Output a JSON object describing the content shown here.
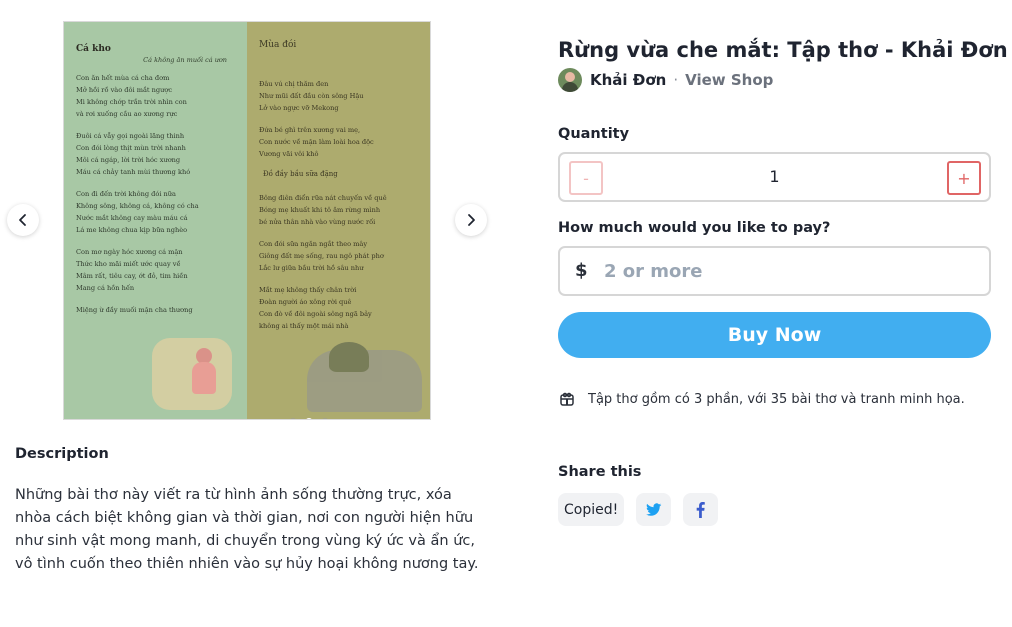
{
  "carousel": {
    "left_page": {
      "title": "Cá kho",
      "subtitle": "Cá không ăn muối cá ươn",
      "stanzas": [
        [
          "Con ăn hết mùa cá cha đơm",
          "Mở hồi rồ vào đôi mắt ngược",
          "Mi không chớp trắn trời nhìn con",
          "và rơi xuống cầu ao xương rực"
        ],
        [
          "Đuôi cá vẫy gọi ngoài lãng thinh",
          "Con đói lòng thịt mùn trời nhanh",
          "Môi cá ngáp, lời trời hóc xương",
          "Máu cá chảy tanh mùi thương khó"
        ],
        [
          "Con đi đến trời không đói nữa",
          "Không sông, không cá, không có cha",
          "Nước mắt không cay màu máu cá",
          "Lá me không chua kịp bữa nghèo"
        ],
        [
          "Con mơ ngày hóc xương cá mặn",
          "Thức kho mãi miết ước quay về",
          "Mâm rất, tiêu cay, ớt đỏ, tim hiền",
          "Mang cá hồn hến"
        ],
        [
          "Miệng ừ đầy muối mặn cha thương"
        ]
      ]
    },
    "right_page": {
      "title": "Mùa đói",
      "stanzas": [
        [
          "Đâu vú chị thăm đen",
          "Như mũi đất đầu còn sông Hậu",
          "Lở vào ngực vỡ Mekong"
        ],
        [
          "Đứa bé ghì trên xương vai mẹ,",
          "Con nước về mặn làm loài hoa độc",
          "Vương vãi vôi khô"
        ],
        [
          "Bông điên điển rữa nát chuyến về quê",
          "Bóng mẹ khuất khi tô ăm rừng mình",
          "bé nửa thân nhà vào vùng nước rối"
        ],
        [
          "Con đói sữa ngăn ngắt theo mây",
          "Giông đất mẹ sống, rau ngô phát phơ",
          "Lắc lư giữa bầu trời hồ sâu như"
        ],
        [
          "Mắt mẹ không thấy chân trời",
          "Đoàn người áo xông rời quê",
          "Con đò về đôi ngoài sông ngã bảy",
          "không ai thấy một mái nhà"
        ]
      ],
      "heading_mid": "Đồ đầy bầu sữa đặng"
    },
    "slide_count": 3,
    "active_slide": 2
  },
  "description": {
    "heading": "Description",
    "body": "Những bài thơ này viết ra từ hình ảnh sống thường trực, xóa nhòa cách biệt không gian và thời gian, nơi con người hiện hữu như sinh vật mong manh, di chuyển trong vùng ký ức và ẩn ức, vô tình cuốn theo thiên nhiên vào sự hủy hoại không nương tay."
  },
  "product": {
    "title": "Rừng vừa che mắt: Tập thơ - Khải Đơn",
    "author": "Khải Đơn",
    "separator": "·",
    "view_shop": "View Shop"
  },
  "quantity": {
    "label": "Quantity",
    "value": "1",
    "minus": "-",
    "plus": "+"
  },
  "price": {
    "label": "How much would you like to pay?",
    "currency": "$",
    "placeholder": "2 or more"
  },
  "buy_button": "Buy Now",
  "info": {
    "icon": "gift-box-icon",
    "text": "Tập thơ gồm có 3 phần, với 35 bài thơ và tranh minh họa."
  },
  "share": {
    "heading": "Share this",
    "copied_label": "Copied!",
    "twitter_icon": "twitter-icon",
    "facebook_icon": "facebook-icon"
  },
  "colors": {
    "accent": "#41aef0",
    "stepper_red": "#e06565",
    "twitter": "#1da1f2",
    "facebook": "#3b5ccc"
  }
}
